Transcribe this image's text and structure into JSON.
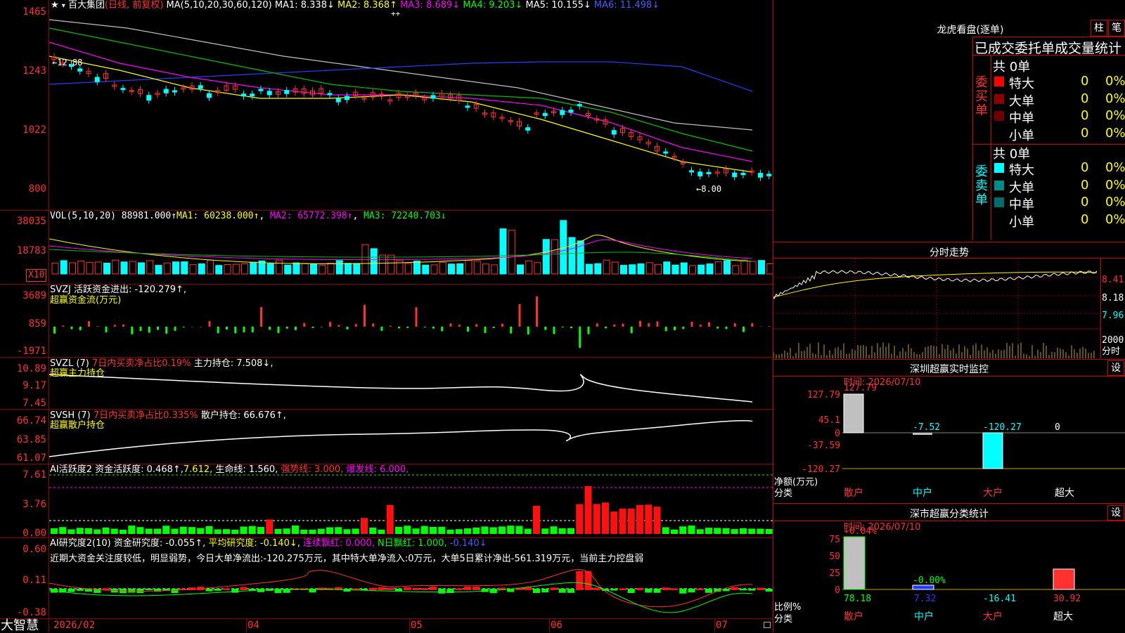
{
  "stock": {
    "name": "百大集团",
    "period_mode": "(日线, 前复权)",
    "ma_label": "MA(5,10,20,30,60,120)",
    "ma1": "MA1: 8.338↓",
    "ma2": "MA2: 8.368↑",
    "ma3": "MA3: 8.689↓",
    "ma4": "MA4: 9.203↓",
    "ma5": "MA5: 10.155↓",
    "ma6": "MA6: 11.498↓",
    "high_mark": "←12.88",
    "low_mark": "←8.00",
    "plus_mark": "++"
  },
  "price_axis": [
    "1465",
    "1243",
    "1022",
    "800"
  ],
  "vol": {
    "label": "VOL(5,10,20)",
    "value": "88981.000↑",
    "ma1": "MA1: 60238.000↑",
    "ma2": "MA2: 65772.398↑",
    "ma3": "MA3: 72240.703↓",
    "axis": [
      "38035",
      "18783"
    ],
    "unit": "X10"
  },
  "svzj": {
    "label": "SVZJ",
    "text1": "活跃资金进出: -120.279↑,",
    "text2": "超赢资金流(万元)",
    "axis": [
      "3689",
      "859",
      "-1971"
    ]
  },
  "svzl": {
    "label": "SVZL (7)",
    "text1": "7日内买卖净占比0.19%",
    "text2": "主力持仓: 7.508↓,",
    "text3": "超赢主力持仓",
    "axis": [
      "10.89",
      "9.17",
      "7.45"
    ]
  },
  "svsh": {
    "label": "SVSH (7)",
    "text1": "7日内买卖净占比0.335%",
    "text2": "散户持仓: 66.676↑,",
    "text3": "超赢散户持仓",
    "axis": [
      "66.74",
      "63.85",
      "61.07"
    ]
  },
  "ai1": {
    "label": "AI活跃度2",
    "text1": "资金活跃度: 0.468↑,",
    "text2": "7.612,",
    "text3": "生命线: 1.560,",
    "text4": "强势线: 3.000,",
    "text5": "爆发线: 6.000,",
    "axis": [
      "7.61",
      "3.76",
      "0.00"
    ]
  },
  "ai2": {
    "label": "AI研究度2(10)",
    "text1": "资金研究度: -0.055↑,",
    "text2": "平均研究度: -0.140↓,",
    "text3": "连续飘红: 0.000,",
    "text4": "N日飘红: 1.000,",
    "text5": "-0.140↓",
    "comment": "近期大资金关注度较低，明显弱势，今日大单净流出:-120.275万元，其中特大单净流入:0万元，大单5日累计净出-561.319万元，当前主力控盘弱",
    "axis": [
      "0.60",
      "0.11",
      "-0.38"
    ]
  },
  "xaxis": [
    "2026/02",
    "04",
    "05",
    "06",
    "07"
  ],
  "brand": "大智慧",
  "right": {
    "lhb_title": "龙虎看盘(逐单)",
    "btn_zhu": "柱",
    "btn_bi": "笔",
    "stats_title": "已成交委托单成交量统计",
    "buy_label": "委买单",
    "sell_label": "委卖单",
    "buy_total": "共 0单",
    "sell_total": "共 0单",
    "buy_rows": [
      {
        "name": "特大",
        "count": "0",
        "pct": "0%",
        "color": "#ff0000"
      },
      {
        "name": "大单",
        "count": "0",
        "pct": "0%",
        "color": "#8b0000"
      },
      {
        "name": "中单",
        "count": "0",
        "pct": "0%",
        "color": "#6b0000"
      },
      {
        "name": "小单",
        "count": "0",
        "pct": "0%",
        "color": "#000000"
      }
    ],
    "sell_rows": [
      {
        "name": "特大",
        "count": "0",
        "pct": "0%",
        "color": "#00ffff"
      },
      {
        "name": "大单",
        "count": "0",
        "pct": "0%",
        "color": "#008b8b"
      },
      {
        "name": "中单",
        "count": "0",
        "pct": "0%",
        "color": "#006b6b"
      },
      {
        "name": "小单",
        "count": "0",
        "pct": "0%",
        "color": "#000000"
      }
    ],
    "intraday_title": "分时走势",
    "intraday_axis": [
      "8.41",
      "8.18",
      "7.96"
    ],
    "intraday_vol": [
      "2000",
      "分时"
    ],
    "monitor_title": "深圳超赢实时监控",
    "monitor_set": "设",
    "monitor_time": "时间: 2026/07/10",
    "monitor_axis": [
      "127.79",
      "45.1",
      "0",
      "-37.59",
      "-120.27"
    ],
    "monitor_values": [
      "127.79",
      "-7.52",
      "-120.27",
      "0"
    ],
    "monitor_ylabel": "净额(万元)",
    "monitor_xlabel": "分类",
    "monitor_cats": [
      "散户",
      "中户",
      "大户",
      "超大"
    ],
    "class_title": "深市超赢分类统计",
    "class_set": "设",
    "class_time": "时间: 2026/07/10",
    "class_axis": [
      "75",
      "50",
      "25",
      "0"
    ],
    "class_top": [
      "+0.04%",
      "-0.00%"
    ],
    "class_values": [
      "78.18",
      "7.32",
      "-16.41",
      "30.92"
    ],
    "class_ylabel": "比例%",
    "class_xlabel": "分类",
    "class_cats": [
      "散户",
      "中户",
      "大户",
      "超大"
    ]
  }
}
